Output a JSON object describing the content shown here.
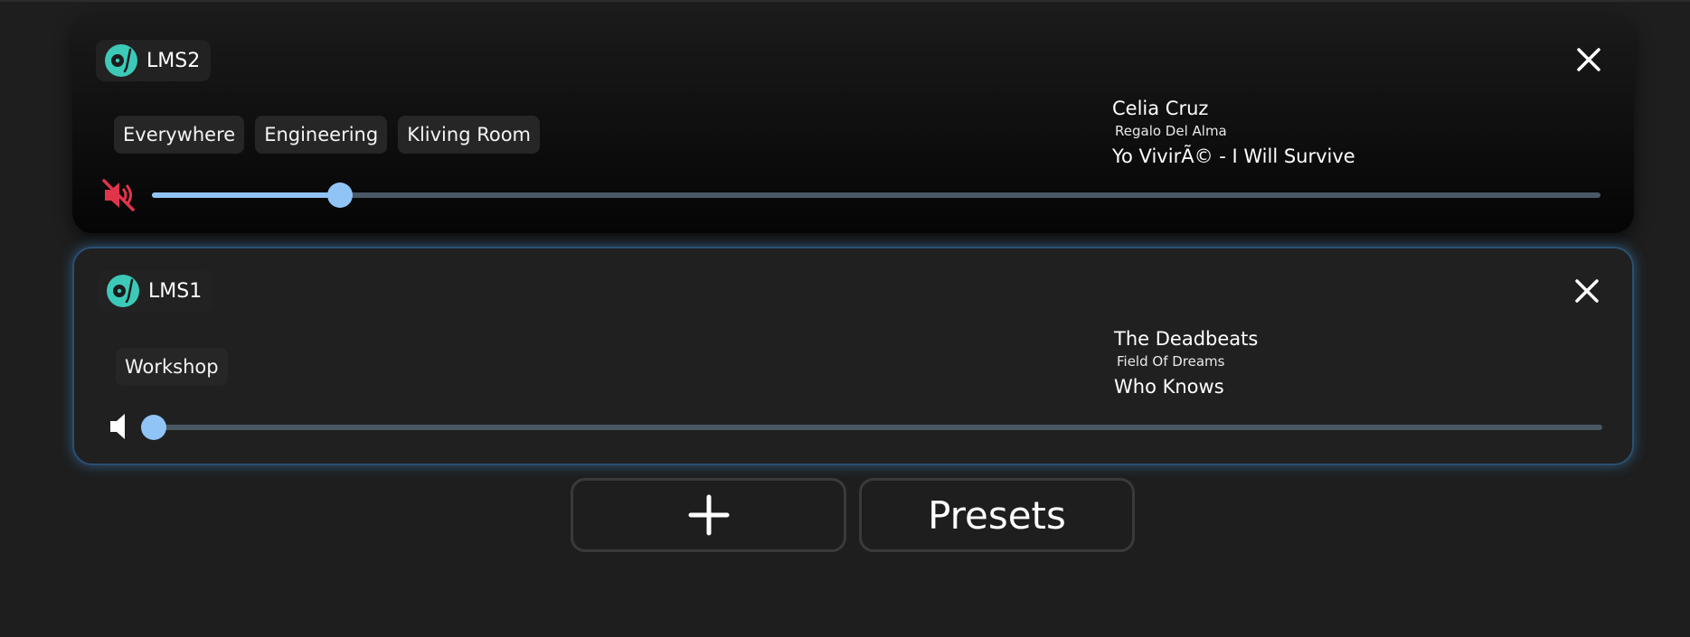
{
  "players": [
    {
      "name": "LMS2",
      "zones": [
        "Everywhere",
        "Engineering",
        "Kliving Room"
      ],
      "artist": "Celia Cruz",
      "album": "Regalo Del Alma",
      "track": "Yo VivirÃ© - I Will Survive",
      "muted": true,
      "volume": 0.13
    },
    {
      "name": "LMS1",
      "zones": [
        "Workshop"
      ],
      "artist": "The Deadbeats",
      "album": "Field Of Dreams",
      "track": "Who Knows",
      "muted": false,
      "volume": 0.0
    }
  ],
  "footer": {
    "add_icon": "plus-icon",
    "presets_label": "Presets"
  },
  "colors": {
    "accent": "#90c4f7",
    "mute_red": "#e0344a",
    "logo_teal": "#3cc9b8",
    "selected_glow": "#3c8cd2"
  }
}
